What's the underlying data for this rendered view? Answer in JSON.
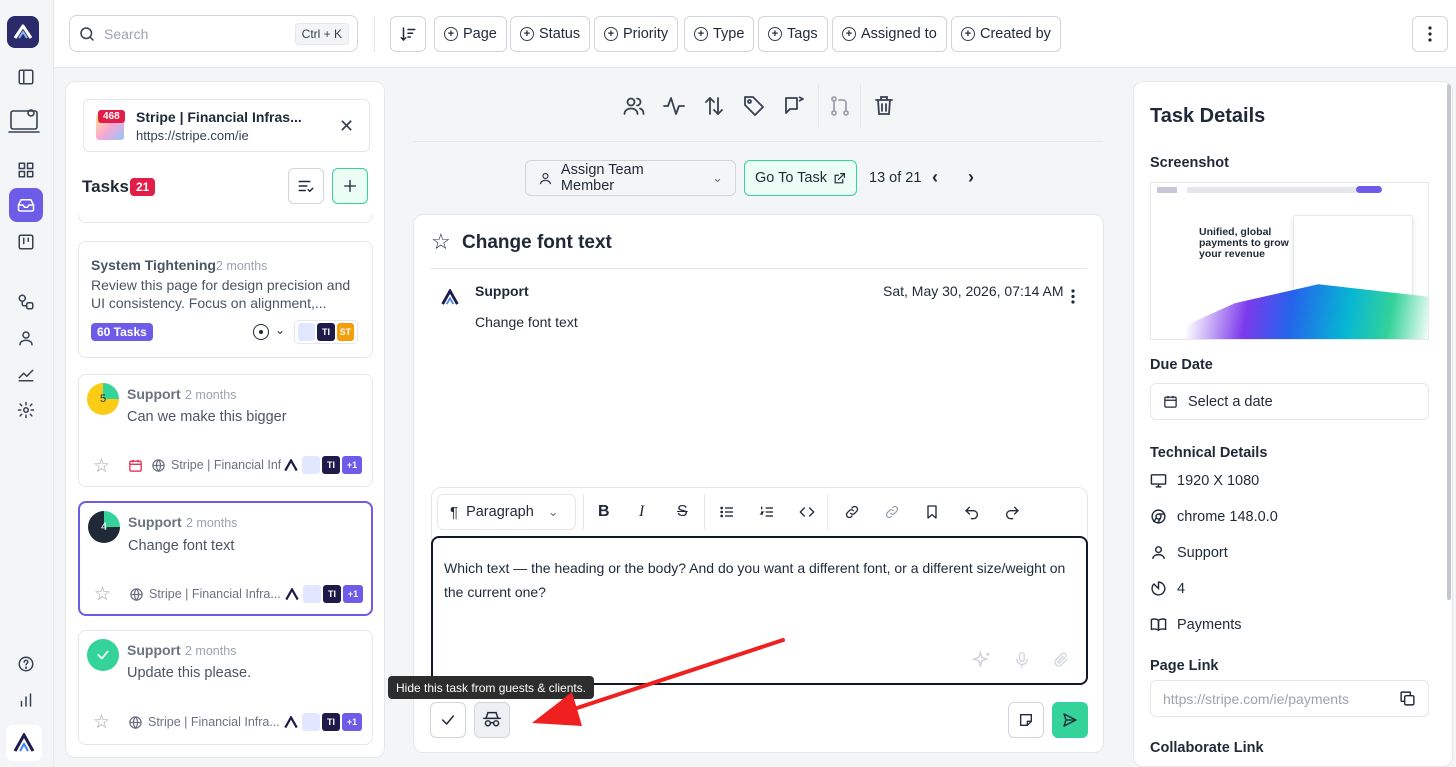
{
  "search": {
    "placeholder": "Search",
    "shortcut": "Ctrl + K"
  },
  "filters": [
    "Page",
    "Status",
    "Priority",
    "Type",
    "Tags",
    "Assigned to",
    "Created by"
  ],
  "site": {
    "badge": "468",
    "title": "Stripe | Financial Infras...",
    "url": "https://stripe.com/ie"
  },
  "tasks_header": {
    "label": "Tasks",
    "count": "21"
  },
  "group_card": {
    "title": "System Tightening",
    "time": "2 months",
    "desc_1": "Review this page for design precision and",
    "desc_2": "UI consistency. Focus on alignment,...",
    "tasks_badge": "60 Tasks",
    "avatar_1": "TI",
    "avatar_2": "ST"
  },
  "task_cards": [
    {
      "num": "5",
      "type": "Support",
      "time": "2 months",
      "text": "Can we make this bigger",
      "site": "Stripe | Financial Infr",
      "avatar": "TI",
      "more": "+1"
    },
    {
      "num": "4",
      "type": "Support",
      "time": "2 months",
      "text": "Change font text",
      "site": "Stripe | Financial Infra...",
      "avatar": "TI",
      "more": "+1"
    },
    {
      "num": "",
      "type": "Support",
      "time": "2 months",
      "text": "Update this please.",
      "site": "Stripe | Financial Infra...",
      "avatar": "TI",
      "more": "+1"
    }
  ],
  "nav": {
    "assign_label": "Assign Team Member",
    "go_label": "Go To Task",
    "position": "13 of 21"
  },
  "task": {
    "title": "Change font text",
    "author": "Support",
    "datetime": "Sat, May 30, 2026, 07:14 AM",
    "body": "Change font text"
  },
  "editor": {
    "paragraph": "Paragraph",
    "text_1": "Which text — the heading or the body? And do you want a different font, or a different size/weight on",
    "text_2": "the current one?"
  },
  "tooltip": "Hide this task from guests & clients.",
  "details": {
    "title": "Task Details",
    "screenshot_label": "Screenshot",
    "shot_headline_1": "Unified, global",
    "shot_headline_2": "payments to grow",
    "shot_headline_3": "your revenue",
    "due_label": "Due Date",
    "due_placeholder": "Select a date",
    "tech_label": "Technical Details",
    "resolution": "1920 X 1080",
    "browser": "chrome 148.0.0",
    "type": "Support",
    "priority": "4",
    "category": "Payments",
    "page_link_label": "Page Link",
    "page_link": "https://stripe.com/ie/payments",
    "collab_label": "Collaborate Link"
  },
  "colors": {
    "accent": "#6d5ce8",
    "green": "#34d399",
    "red": "#e11d48",
    "navy": "#1e1b4b"
  }
}
